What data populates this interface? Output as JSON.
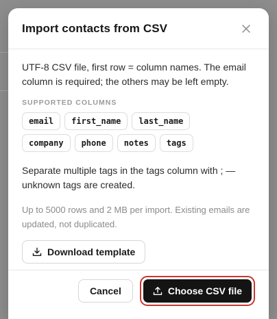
{
  "dialog": {
    "title": "Import contacts from CSV",
    "intro": "UTF-8 CSV file, first row = column names. The email column is required; the others may be left empty.",
    "supported_label": "SUPPORTED COLUMNS",
    "columns": [
      "email",
      "first_name",
      "last_name",
      "company",
      "phone",
      "notes",
      "tags"
    ],
    "tags_note": "Separate multiple tags in the tags column with ; — unknown tags are created.",
    "limits_note": "Up to 5000 rows and 2 MB per import. Existing emails are updated, not duplicated.",
    "download_label": "Download template",
    "cancel_label": "Cancel",
    "choose_label": "Choose CSV file"
  },
  "icons": {
    "close": "close-icon",
    "download": "download-icon",
    "upload": "upload-icon"
  },
  "colors": {
    "primary": "#141414",
    "highlight": "#c7372f"
  }
}
